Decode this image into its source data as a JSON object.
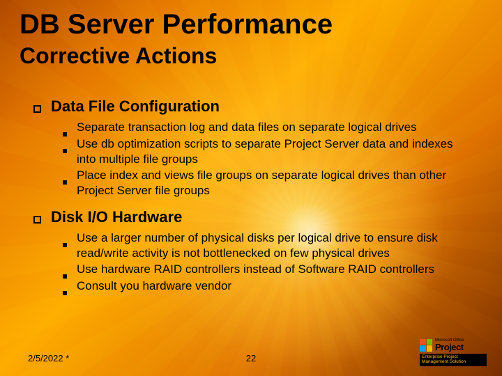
{
  "title": "DB Server Performance",
  "subtitle": "Corrective Actions",
  "sections": [
    {
      "heading": "Data File Configuration",
      "items": [
        "Separate transaction log and data files on separate logical drives",
        "Use db optimization scripts to separate Project Server data and indexes into multiple file groups",
        "Place index and views file groups on separate logical drives than other Project Server file groups"
      ]
    },
    {
      "heading": "Disk I/O Hardware",
      "items": [
        "Use a larger number of physical disks per logical drive to ensure disk read/write activity is not bottlenecked on few physical drives",
        "Use hardware RAID controllers instead of Software RAID controllers",
        "Consult you hardware vendor"
      ]
    }
  ],
  "footer": {
    "date": "2/5/2022 *",
    "page": "22"
  },
  "logo": {
    "vendor": "Microsoft Office",
    "product": "Project",
    "tagline1": "Enterprise Project",
    "tagline2": "Management Solution"
  }
}
